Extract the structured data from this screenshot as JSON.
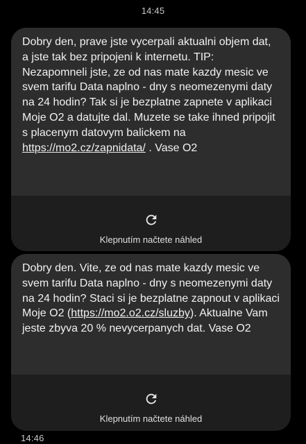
{
  "timestamps": {
    "top": "14:45",
    "bottom": "14:46"
  },
  "messages": [
    {
      "text_before_link": "Dobry den, prave jste vycerpali aktualni objem dat, a jste tak bez pripojeni k internetu. TIP: Nezapomneli jste, ze od nas mate kazdy mesic ve svem tarifu Data naplno - dny s neomezenymi daty na 24 hodin? Tak si je bezplatne zapnete v aplikaci Moje O2 a datujte dal. Muzete se take ihned pripojit s placenym datovym balickem na ",
      "link": "https://mo2.cz/zapnidata/",
      "text_after_link": " . Vase O2",
      "preview_label": "Klepnutím načtete náhled",
      "preview_icon": "reload-icon"
    },
    {
      "text_before_link": "Dobry den. Vite, ze od nas mate kazdy mesic ve svem tarifu Data naplno - dny s neomezenymi daty na 24 hodin? Staci si je bezplatne zapnout v aplikaci Moje O2 (",
      "link": "https://mo2.o2.cz/sluzby",
      "text_after_link": "). Aktualne Vam jeste zbyva 20 % nevycerpanych dat. Vase O2",
      "preview_label": "Klepnutím načtete náhled",
      "preview_icon": "reload-icon"
    }
  ],
  "colors": {
    "background": "#000000",
    "bubble_text_area": "#2d2d2d",
    "preview_area": "#1e1e1e",
    "text": "#f1f1f1",
    "timestamp": "#c9c9c9"
  }
}
